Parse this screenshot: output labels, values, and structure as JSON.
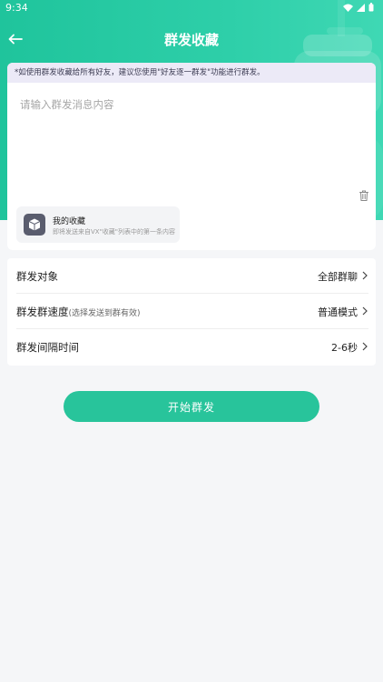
{
  "status_bar": {
    "time": "9:34"
  },
  "header": {
    "title": "群发收藏"
  },
  "compose": {
    "notice": "*如使用群发收藏给所有好友，建议您使用\"好友逐一群发\"功能进行群发。",
    "placeholder": "请输入群发消息内容",
    "favorite": {
      "title": "我的收藏",
      "subtitle": "即将发送来自VX\"收藏\"列表中的第一条内容"
    }
  },
  "settings": {
    "target": {
      "label": "群发对象",
      "value": "全部群聊"
    },
    "speed": {
      "label": "群发群速度",
      "hint": "(选择发送到群有效)",
      "value": "普通模式"
    },
    "interval": {
      "label": "群发间隔时间",
      "value": "2-6秒"
    }
  },
  "actions": {
    "start_label": "开始群发"
  },
  "colors": {
    "brand": "#28c49b",
    "header_gradient_start": "#1fc49c",
    "notice_bg": "#eceaf7",
    "page_bg": "#f5f6f8"
  },
  "icons": {
    "back": "arrow-left-icon",
    "trash": "trash-icon",
    "favorite": "cube-box-icon",
    "chevron": "chevron-right-icon"
  }
}
